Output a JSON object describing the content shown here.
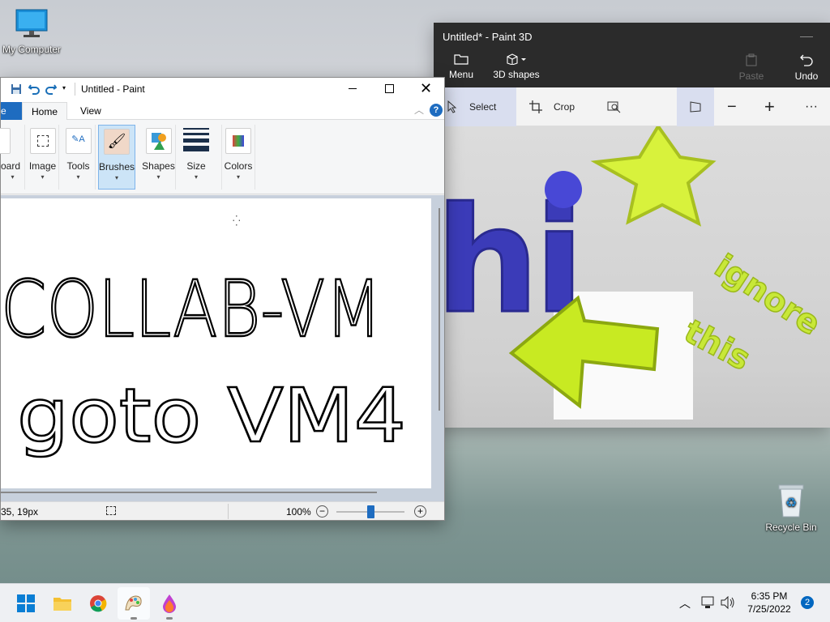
{
  "desktop": {
    "icons": [
      {
        "label": "My Computer",
        "icon": "monitor-icon"
      },
      {
        "label": "Recycle Bin",
        "icon": "recycle-bin-icon"
      }
    ]
  },
  "paint": {
    "title": "Untitled - Paint",
    "tabs": [
      "e",
      "Home",
      "View"
    ],
    "ribbon": [
      "oard",
      "Image",
      "Tools",
      "Brushes",
      "Shapes",
      "Size",
      "Colors"
    ],
    "canvas_text": [
      "COLLAB-VM",
      "goto VM4"
    ],
    "status": {
      "coords": "35, 19px",
      "zoom": "100%"
    },
    "zoom_level": 0.5
  },
  "paint3d": {
    "title": "Untitled* - Paint 3D",
    "top_buttons": {
      "menu": "Menu",
      "shapes": "3D shapes",
      "paste": "Paste",
      "undo": "Undo"
    },
    "toolbar": {
      "select": "Select",
      "crop": "Crop"
    },
    "scene_text": {
      "hi": "hi",
      "ignore": "ignore",
      "this": "this"
    }
  },
  "taskbar": {
    "time": "6:35 PM",
    "date": "7/25/2022",
    "notifications": "2",
    "apps": [
      "start-icon",
      "file-explorer-icon",
      "chrome-icon",
      "paint-icon",
      "paint3d-icon"
    ]
  },
  "colors": {
    "accent": "#0067c0",
    "lime": "#d6f23a",
    "blue": "#4a4ad0"
  }
}
